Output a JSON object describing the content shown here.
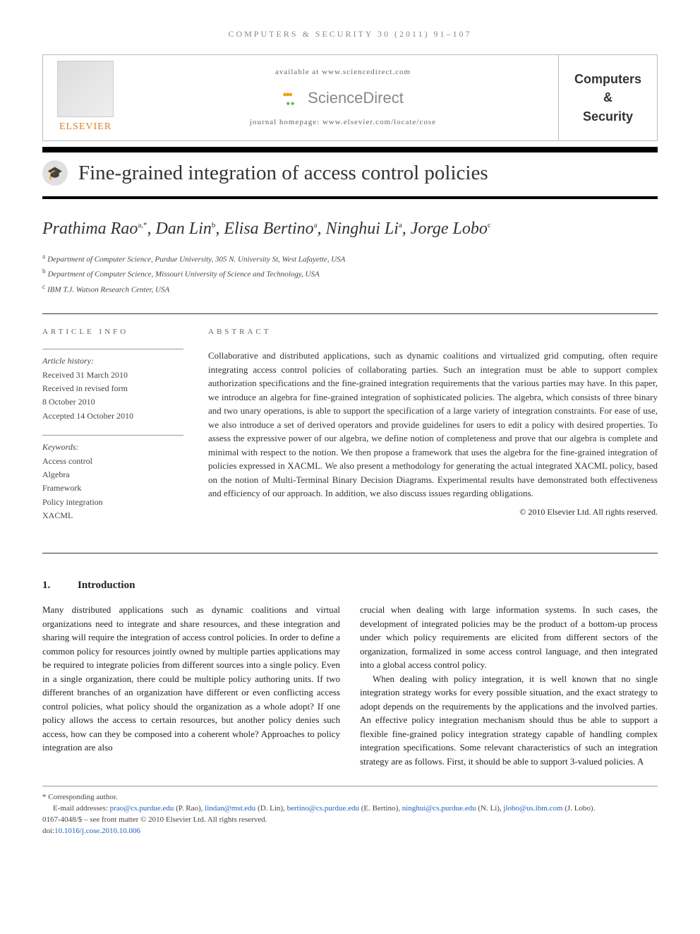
{
  "journal_citation": "COMPUTERS & SECURITY 30 (2011) 91–107",
  "header": {
    "elsevier_label": "ELSEVIER",
    "available_at": "available at www.sciencedirect.com",
    "sciencedirect": "ScienceDirect",
    "homepage_label": "journal homepage: www.elsevier.com/locate/cose",
    "journal_name_1": "Computers",
    "journal_name_2": "&",
    "journal_name_3": "Security"
  },
  "title": "Fine-grained integration of access control policies",
  "authors_html": "Prathima Rao",
  "authors": [
    {
      "name": "Prathima Rao",
      "aff": "a,*"
    },
    {
      "name": "Dan Lin",
      "aff": "b"
    },
    {
      "name": "Elisa Bertino",
      "aff": "a"
    },
    {
      "name": "Ninghui Li",
      "aff": "a"
    },
    {
      "name": "Jorge Lobo",
      "aff": "c"
    }
  ],
  "affiliations": {
    "a": "Department of Computer Science, Purdue University, 305 N. University St, West Lafayette, USA",
    "b": "Department of Computer Science, Missouri University of Science and Technology, USA",
    "c": "IBM T.J. Watson Research Center, USA"
  },
  "article_info": {
    "heading": "ARTICLE INFO",
    "history_label": "Article history:",
    "received": "Received 31 March 2010",
    "revised_label": "Received in revised form",
    "revised_date": "8 October 2010",
    "accepted": "Accepted 14 October 2010",
    "keywords_label": "Keywords:",
    "keywords": [
      "Access control",
      "Algebra",
      "Framework",
      "Policy integration",
      "XACML"
    ]
  },
  "abstract": {
    "heading": "ABSTRACT",
    "text": "Collaborative and distributed applications, such as dynamic coalitions and virtualized grid computing, often require integrating access control policies of collaborating parties. Such an integration must be able to support complex authorization specifications and the fine-grained integration requirements that the various parties may have. In this paper, we introduce an algebra for fine-grained integration of sophisticated policies. The algebra, which consists of three binary and two unary operations, is able to support the specification of a large variety of integration constraints. For ease of use, we also introduce a set of derived operators and provide guidelines for users to edit a policy with desired properties. To assess the expressive power of our algebra, we define notion of completeness and prove that our algebra is complete and minimal with respect to the notion. We then propose a framework that uses the algebra for the fine-grained integration of policies expressed in XACML. We also present a methodology for generating the actual integrated XACML policy, based on the notion of Multi-Terminal Binary Decision Diagrams. Experimental results have demonstrated both effectiveness and efficiency of our approach. In addition, we also discuss issues regarding obligations.",
    "copyright": "© 2010 Elsevier Ltd. All rights reserved."
  },
  "section1": {
    "num": "1.",
    "title": "Introduction",
    "col1": "Many distributed applications such as dynamic coalitions and virtual organizations need to integrate and share resources, and these integration and sharing will require the integration of access control policies. In order to define a common policy for resources jointly owned by multiple parties applications may be required to integrate policies from different sources into a single policy. Even in a single organization, there could be multiple policy authoring units. If two different branches of an organization have different or even conflicting access control policies, what policy should the organization as a whole adopt? If one policy allows the access to certain resources, but another policy denies such access, how can they be composed into a coherent whole? Approaches to policy integration are also",
    "col2_p1": "crucial when dealing with large information systems. In such cases, the development of integrated policies may be the product of a bottom-up process under which policy requirements are elicited from different sectors of the organization, formalized in some access control language, and then integrated into a global access control policy.",
    "col2_p2": "When dealing with policy integration, it is well known that no single integration strategy works for every possible situation, and the exact strategy to adopt depends on the requirements by the applications and the involved parties. An effective policy integration mechanism should thus be able to support a flexible fine-grained policy integration strategy capable of handling complex integration specifications. Some relevant characteristics of such an integration strategy are as follows. First, it should be able to support 3-valued policies. A"
  },
  "footnotes": {
    "corresponding": "* Corresponding author.",
    "email_label": "E-mail addresses:",
    "emails": [
      {
        "addr": "prao@cs.purdue.edu",
        "name": "(P. Rao)"
      },
      {
        "addr": "lindan@mst.edu",
        "name": "(D. Lin)"
      },
      {
        "addr": "bertino@cs.purdue.edu",
        "name": "(E. Bertino)"
      },
      {
        "addr": "ninghui@cs.purdue.edu",
        "name": "(N. Li)"
      },
      {
        "addr": "jlobo@us.ibm.com",
        "name": "(J. Lobo)"
      }
    ],
    "issn_line": "0167-4048/$ – see front matter © 2010 Elsevier Ltd. All rights reserved.",
    "doi_label": "doi:",
    "doi": "10.1016/j.cose.2010.10.006"
  }
}
